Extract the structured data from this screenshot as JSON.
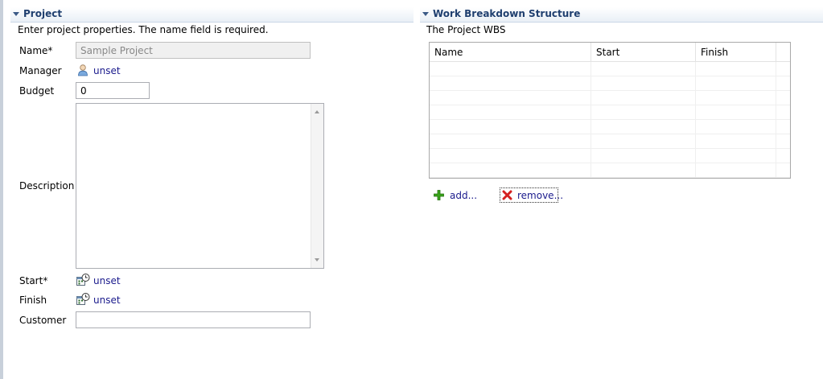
{
  "project": {
    "title": "Project",
    "description": "Enter project properties. The name field is required.",
    "fields": {
      "name_label": "Name*",
      "name_value": "Sample Project",
      "manager_label": "Manager",
      "manager_value": "unset",
      "budget_label": "Budget",
      "budget_value": "0",
      "description_label": "Description",
      "start_label": "Start*",
      "start_value": "unset",
      "finish_label": "Finish",
      "finish_value": "unset",
      "customer_label": "Customer",
      "customer_value": ""
    }
  },
  "wbs": {
    "title": "Work Breakdown Structure",
    "description": "The Project WBS",
    "columns": [
      "Name",
      "Start",
      "Finish"
    ],
    "add_label": "add...",
    "remove_label": "remove..."
  },
  "colors": {
    "section_title": "#1f3f6f",
    "link": "#1a1a8c",
    "add_icon": "#3aa51a",
    "remove_icon": "#d42020"
  },
  "icons": {
    "manager": "user-icon",
    "start": "date-time-icon",
    "finish": "date-time-icon",
    "add": "plus-icon",
    "remove": "red-x-icon"
  }
}
